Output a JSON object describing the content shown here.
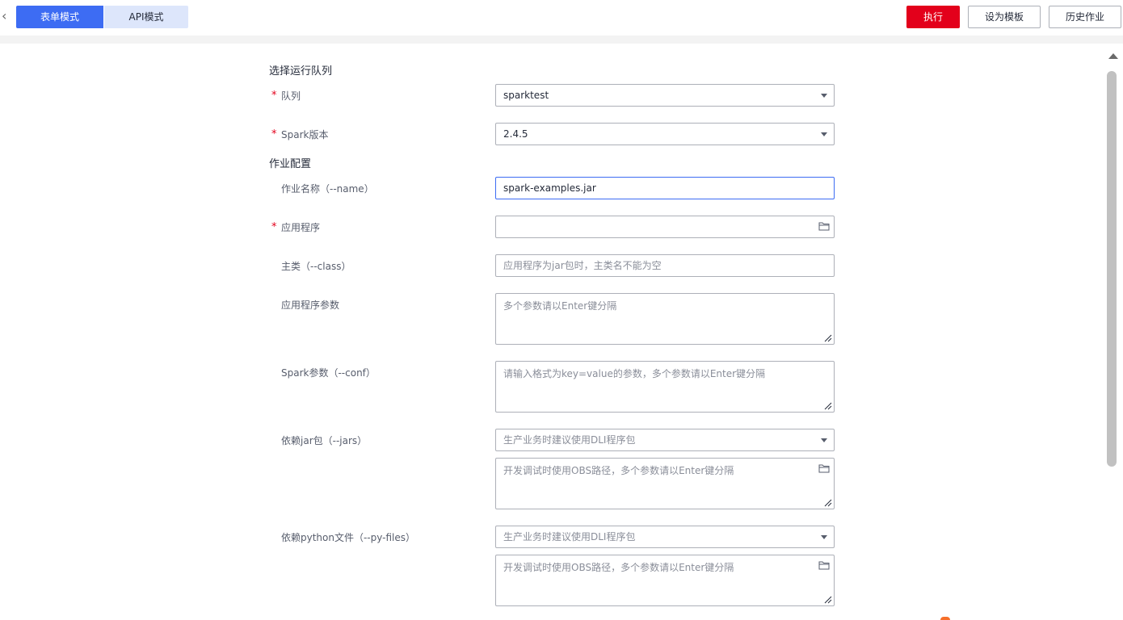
{
  "header": {
    "back_icon": "chevron-left-icon",
    "tabs": [
      {
        "label": "表单模式",
        "active": true
      },
      {
        "label": "API模式",
        "active": false
      }
    ],
    "buttons": {
      "run": "执行",
      "save_template": "设为模板",
      "history": "历史作业"
    }
  },
  "colors": {
    "accent": "#3d6cf3",
    "danger": "#e3001b",
    "border": "#adb0b8"
  },
  "form": {
    "section_queue": "选择运行队列",
    "queue_label": "队列",
    "queue_value": "sparktest",
    "spark_version_label": "Spark版本",
    "spark_version_value": "2.4.5",
    "section_job": "作业配置",
    "job_name_label": "作业名称（--name）",
    "job_name_value": "spark-examples.jar",
    "app_label": "应用程序",
    "app_value": "",
    "main_class_label": "主类（--class）",
    "main_class_placeholder": "应用程序为jar包时，主类名不能为空",
    "app_args_label": "应用程序参数",
    "app_args_placeholder": "多个参数请以Enter键分隔",
    "spark_conf_label": "Spark参数（--conf）",
    "spark_conf_placeholder": "请输入格式为key=value的参数，多个参数请以Enter键分隔",
    "jars_label": "依赖jar包（--jars）",
    "jars_select_placeholder": "生产业务时建议使用DLI程序包",
    "jars_path_placeholder": "开发调试时使用OBS路径，多个参数请以Enter键分隔",
    "pyfiles_label": "依赖python文件（--py-files）",
    "pyfiles_select_placeholder": "生产业务时建议使用DLI程序包",
    "pyfiles_path_placeholder": "开发调试时使用OBS路径，多个参数请以Enter键分隔"
  }
}
